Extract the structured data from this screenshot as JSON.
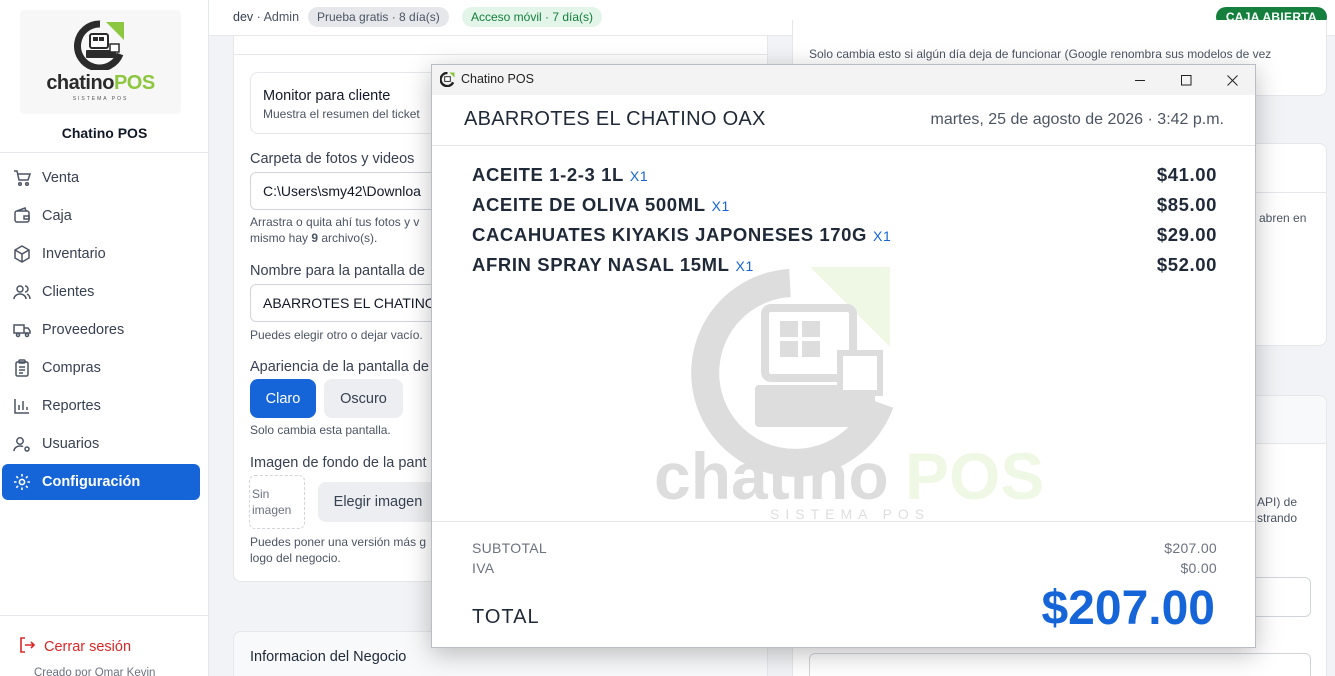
{
  "sidebar": {
    "logo_text_main": "chatino",
    "logo_text_pos": "POS",
    "logo_sub": "SISTEMA POS",
    "brand": "Chatino POS",
    "items": [
      {
        "label": "Venta",
        "icon": "cart-icon"
      },
      {
        "label": "Caja",
        "icon": "wallet-icon"
      },
      {
        "label": "Inventario",
        "icon": "box-icon"
      },
      {
        "label": "Clientes",
        "icon": "users-icon"
      },
      {
        "label": "Proveedores",
        "icon": "truck-icon"
      },
      {
        "label": "Compras",
        "icon": "clipboard-icon"
      },
      {
        "label": "Reportes",
        "icon": "bar-chart-icon"
      },
      {
        "label": "Usuarios",
        "icon": "user-gear-icon"
      },
      {
        "label": "Configuración",
        "icon": "gear-icon",
        "active": true
      }
    ],
    "logout": "Cerrar sesión",
    "created_by": "Creado por Omar Kevin"
  },
  "topbar": {
    "user": "dev",
    "role": "· Admin",
    "trial_badge": "Prueba gratis · 8 día(s)",
    "mobile_badge": "Acceso móvil · 7 día(s)",
    "cash_status": "CAJA ABIERTA"
  },
  "settings": {
    "monitor_title": "Monitor para cliente",
    "monitor_desc": "Muestra el resumen del ticket",
    "photos_label": "Carpeta de fotos y videos",
    "photos_path": "C:\\Users\\smy42\\Downloa",
    "photos_help_1": "Arrastra o quita ahí tus fotos y v",
    "photos_help_2a": "mismo hay ",
    "photos_count": "9",
    "photos_help_2b": " archivo(s).",
    "screen_name_label": "Nombre para la pantalla de",
    "screen_name_value": "ABARROTES EL CHATINO",
    "screen_name_help": "Puedes elegir otro o dejar vacío.",
    "appearance_label": "Apariencia de la pantalla de",
    "theme_light": "Claro",
    "theme_dark": "Oscuro",
    "appearance_help": "Solo cambia esta pantalla.",
    "bg_label": "Imagen de fondo de la pant",
    "no_image": "Sin imagen",
    "choose_image": "Elegir imagen",
    "bg_help_1": "Puedes poner una versión más g",
    "bg_help_2": "logo del negocio.",
    "business_info": "Informacion del Negocio",
    "right_help": "Solo cambia esto si algún día deja de funcionar (Google renombra sus modelos de vez",
    "right_frag_1": "abren en",
    "right_frag_2": "API) de",
    "right_frag_3": "strando"
  },
  "window": {
    "title": "Chatino POS",
    "store": "ABARROTES EL CHATINO OAX",
    "datetime": "martes, 25 de agosto de 2026 · 3:42 p.m.",
    "items": [
      {
        "name": "ACEITE 1-2-3 1L",
        "qty": "X1",
        "price": "$41.00"
      },
      {
        "name": "ACEITE DE OLIVA 500ML",
        "qty": "X1",
        "price": "$85.00"
      },
      {
        "name": "CACAHUATES KIYAKIS JAPONESES 170G",
        "qty": "X1",
        "price": "$29.00"
      },
      {
        "name": "AFRIN SPRAY NASAL 15ML",
        "qty": "X1",
        "price": "$52.00"
      }
    ],
    "subtotal_label": "SUBTOTAL",
    "subtotal": "$207.00",
    "iva_label": "IVA",
    "iva": "$0.00",
    "total_label": "TOTAL",
    "total": "$207.00",
    "watermark_main": "chatino",
    "watermark_pos": "POS",
    "watermark_sub": "SISTEMA POS"
  }
}
